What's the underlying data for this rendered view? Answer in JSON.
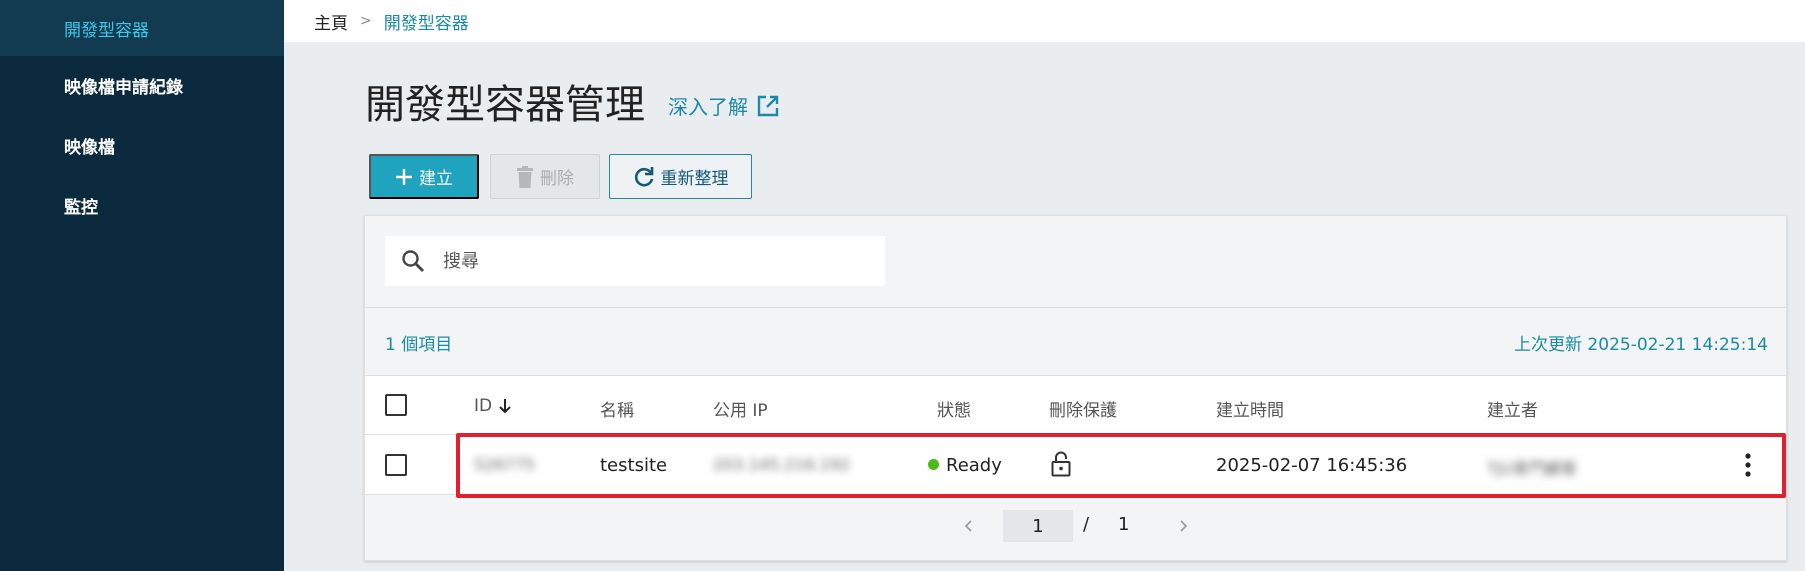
{
  "sidebar": {
    "items": [
      {
        "label": "開發型容器",
        "active": true
      },
      {
        "label": "映像檔申請紀錄",
        "active": false
      },
      {
        "label": "映像檔",
        "active": false
      },
      {
        "label": "監控",
        "active": false
      }
    ]
  },
  "breadcrumb": {
    "home": "主頁",
    "separator": ">",
    "current": "開發型容器"
  },
  "page": {
    "title": "開發型容器管理",
    "learn_more": "深入了解"
  },
  "toolbar": {
    "create_label": "建立",
    "delete_label": "刪除",
    "refresh_label": "重新整理"
  },
  "search": {
    "placeholder": "搜尋",
    "value": ""
  },
  "summary": {
    "count": "1 個項目",
    "last_update": "上次更新 2025-02-21 14:25:14"
  },
  "table": {
    "columns": [
      "ID",
      "名稱",
      "公用 IP",
      "狀態",
      "刪除保護",
      "建立時間",
      "建立者"
    ],
    "rows": [
      {
        "id": "526775",
        "name": "testsite",
        "public_ip": "203.145.216.192",
        "status": "Ready",
        "created_at": "2025-02-07 16:45:36",
        "creator": "TJU家門顧客"
      }
    ]
  },
  "pagination": {
    "current": "1",
    "separator": "/",
    "total": "1"
  },
  "colors": {
    "accent": "#1fa3be",
    "sidebar_bg": "#0b2a3d",
    "highlight": "#e0202e",
    "status_ready": "#4cbb17"
  }
}
